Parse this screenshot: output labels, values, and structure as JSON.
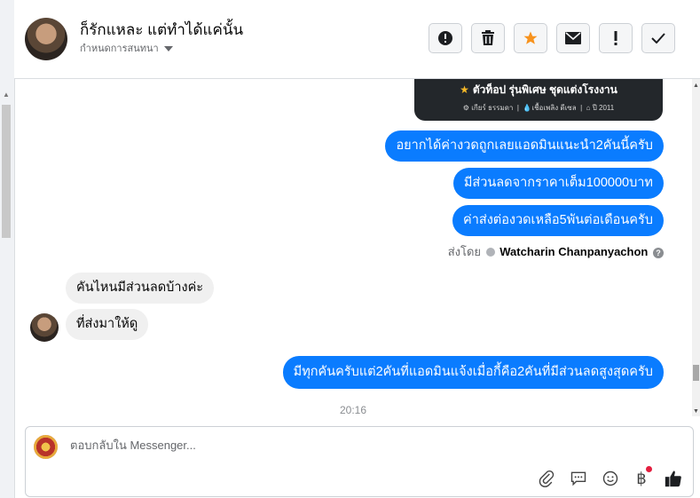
{
  "header": {
    "name": "ก็รักแหละ แต่ทำได้แค่นั้น",
    "sub_label": "กำหนดการสนทนา"
  },
  "product_card": {
    "title": "ตัวท็อป รุ่นพิเศษ ชุดแต่งโรงงาน",
    "meta_gear": "เกียร์ ธรรมดา",
    "meta_fuel": "เชื้อเพลิง ดีเซล",
    "meta_year": "ปี 2011"
  },
  "messages": {
    "out1": "อยากได้ค่างวดถูกเลยแอดมินแนะนำ2คันนี้ครับ",
    "out2": "มีส่วนลดจากราคาเต็ม100000บาท",
    "out3": "ค่าส่งต่องวดเหลือ5พันต่อเดือนครับ",
    "sent_by_prefix": "ส่งโดย",
    "sent_by_name": "Watcharin Chanpanyachon",
    "in1": "คันไหนมีส่วนลดบ้างค่ะ",
    "in2": "ที่ส่งมาให้ดู",
    "out4": "มีทุกคันครับแต่2คันที่แอดมินแจ้งเมื่อกี้คือ2คันที่มีส่วนลดสูงสุดครับ",
    "timestamp": "20:16"
  },
  "composer": {
    "placeholder": "ตอบกลับใน Messenger..."
  },
  "colors": {
    "outgoing_bubble": "#0a7cff",
    "incoming_bubble": "#f0f0f0",
    "star_accent": "#f7931e",
    "notification_dot": "#e41e3f"
  }
}
